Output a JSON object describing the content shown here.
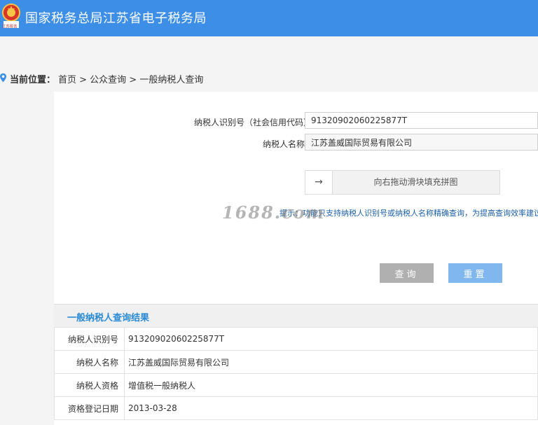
{
  "header": {
    "site_title": "国家税务总局江苏省电子税务局",
    "logo_caption": "江苏税务"
  },
  "breadcrumb": {
    "label": "当前位置：",
    "path": "首页 > 公众查询 > 一般纳税人查询"
  },
  "form": {
    "taxpayer_id_label": "纳税人识别号（社会信用代码）",
    "taxpayer_id_value": "91320902060225877T",
    "taxpayer_name_label": "纳税人名称",
    "taxpayer_name_value": "江苏盖威国际贸易有限公司",
    "slider_arrow": "→",
    "slider_text": "向右拖动滑块填充拼图",
    "hint": "提示：功能只支持纳税人识别号或纳税人名称精确查询，为提高查询效率建议",
    "query_button": "查询",
    "reset_button": "重置"
  },
  "watermark": "1688.com",
  "results": {
    "title": "一般纳税人查询结果",
    "rows": [
      {
        "key": "纳税人识别号",
        "value": "91320902060225877T"
      },
      {
        "key": "纳税人名称",
        "value": "江苏盖威国际贸易有限公司"
      },
      {
        "key": "纳税人资格",
        "value": "增值税一般纳税人"
      },
      {
        "key": "资格登记日期",
        "value": "2013-03-28"
      }
    ]
  },
  "colors": {
    "header_bg": "#3d8ee6",
    "accent_blue": "#2a8ad4",
    "query_btn": "#b0b0b0",
    "reset_btn": "#7fb7ee"
  }
}
